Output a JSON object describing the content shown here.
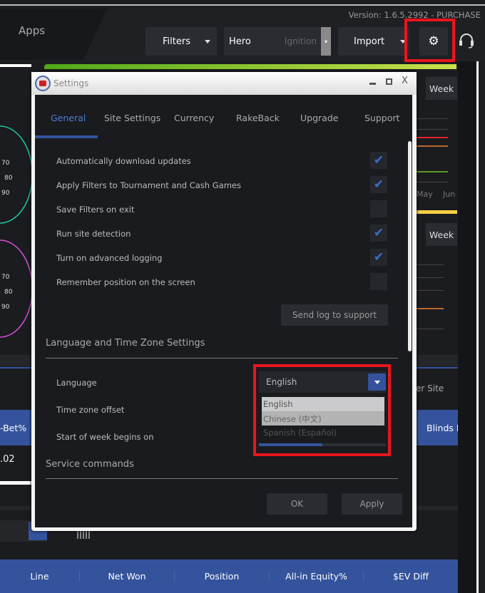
{
  "app": {
    "apps_tab": "Apps",
    "version": "Version: 1.6.5.2992 - PURCHASE"
  },
  "toolbar": {
    "filters": "Filters",
    "player": "Hero",
    "site": "Ignition",
    "import": "Import",
    "settings_icon": "gear-icon",
    "support_icon": "headset-icon"
  },
  "background": {
    "week1": "Week",
    "week2": "Week",
    "month_may": "May",
    "month_jun": "Jun",
    "dial_ticks": [
      "70",
      "80",
      "90"
    ],
    "bet_header": "-Bet%",
    "blinds_header": "Blinds R",
    "cell_value": ".02",
    "per_site": "er Site",
    "table_headers": [
      "Line",
      "Net Won",
      "Position",
      "All-in Equity%",
      "$EV Diff"
    ],
    "line_colors": [
      "#e0252b",
      "#f5c23c",
      "#7dc629"
    ],
    "dial_colors": [
      "#1fc6a0",
      "#d64fd6"
    ]
  },
  "dialog": {
    "title": "Settings",
    "tabs": [
      "General",
      "Site Settings",
      "Currency",
      "RakeBack",
      "Upgrade",
      "Support"
    ],
    "active_tab": "General",
    "options": [
      {
        "label": "Automatically download updates",
        "checked": true
      },
      {
        "label": "Apply Filters to Tournament and Cash Games",
        "checked": true
      },
      {
        "label": "Save Filters on exit",
        "checked": false
      },
      {
        "label": "Run site detection",
        "checked": true
      },
      {
        "label": "Turn on advanced logging",
        "checked": true
      },
      {
        "label": "Remember position on the screen",
        "checked": false
      }
    ],
    "send_log": "Send log to support",
    "lang_section": "Language and Time Zone Settings",
    "language_label": "Language",
    "language_value": "English",
    "language_options": [
      "English",
      "Chinese (中文)",
      "Spanish (Español)"
    ],
    "hovered_option": "Chinese (中文)",
    "timezone_label": "Time zone offset",
    "week_start_label": "Start of week begins on",
    "service_section": "Service commands",
    "ok": "OK",
    "apply": "Apply",
    "accent": "#34539c"
  }
}
